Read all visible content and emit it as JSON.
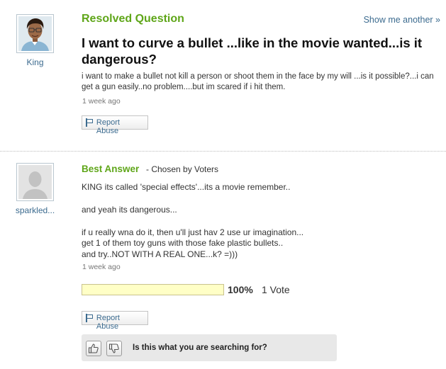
{
  "question": {
    "status": "Resolved Question",
    "show_another": "Show me another »",
    "asker": "King",
    "title": "I want to curve a bullet ...like in the movie wanted...is it dangerous?",
    "body": "i want to make a bullet not kill a person or shoot them in the face by my will ...is it possible?...i can get a gun easily..no problem....but im scared if i hit them.",
    "time": "1 week ago",
    "report_abuse": "Report Abuse",
    "avatar_icon": "cartoon-avatar-icon"
  },
  "answer": {
    "label": "Best Answer",
    "chosen_by": "- Chosen by Voters",
    "answerer": "sparkled...",
    "lines": [
      "KING its called 'special effects'...its a movie remember..",
      "and yeah its dangerous...",
      "if u really wna do it, then u'll just hav 2 use ur imagination...",
      "get 1 of them toy guns with those fake plastic bullets..",
      "and try..NOT WITH A REAL ONE...k? =)))"
    ],
    "time": "1 week ago",
    "vote_percent": "100%",
    "vote_fraction": 1.0,
    "vote_count": "1 Vote",
    "report_abuse": "Report Abuse",
    "avatar_icon": "default-silhouette-icon"
  },
  "feedback": {
    "question": "Is this what you are searching for?",
    "thumbs_up_icon": "thumbs-up-icon",
    "thumbs_down_icon": "thumbs-down-icon"
  },
  "colors": {
    "accent_green": "#5fa619",
    "link_blue": "#3c6b8f",
    "vote_fill": "#ffffc6"
  }
}
